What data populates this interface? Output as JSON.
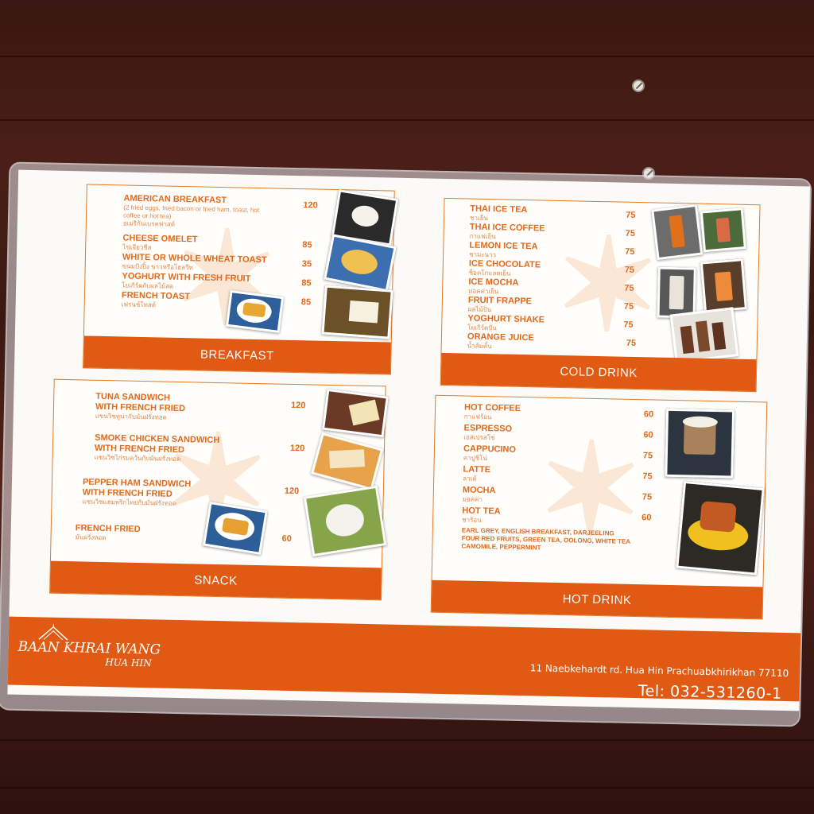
{
  "breakfast": {
    "title": "BREAKFAST",
    "items": [
      {
        "name": "AMERICAN BREAKFAST",
        "desc": "(2 fried eggs, fried bacon or fried ham, toast, hot coffee or hot tea)",
        "thai": "อเมริกันเบรคฟาสต์",
        "price": "120"
      },
      {
        "name": "CHEESE OMELET",
        "thai": "ไข่เจียวชีส",
        "price": "85"
      },
      {
        "name": "WHITE OR WHOLE WHEAT TOAST",
        "thai": "ขนมปังปิ้ง ขาวหรือโฮลวีท",
        "price": "35"
      },
      {
        "name": "YOGHURT WITH FRESH FRUIT",
        "thai": "โยเกิร์ตกับผลไม้สด",
        "price": "85"
      },
      {
        "name": "FRENCH TOAST",
        "thai": "เฟรนช์โทสต์",
        "price": "85"
      }
    ]
  },
  "cold_drink": {
    "title": "COLD DRINK",
    "items": [
      {
        "name": "THAI ICE TEA",
        "thai": "ชาเย็น",
        "price": "75"
      },
      {
        "name": "THAI ICE COFFEE",
        "thai": "กาแฟเย็น",
        "price": "75"
      },
      {
        "name": "LEMON ICE TEA",
        "thai": "ชามะนาว",
        "price": "75"
      },
      {
        "name": "ICE CHOCOLATE",
        "thai": "ช็อคโกแลตเย็น",
        "price": "75"
      },
      {
        "name": "ICE MOCHA",
        "thai": "มอคค่าเย็น",
        "price": "75"
      },
      {
        "name": "FRUIT FRAPPE",
        "thai": "ผลไม้ปั่น",
        "price": "75"
      },
      {
        "name": "YOGHURT SHAKE",
        "thai": "โยเกิร์ตปั่น",
        "price": "75"
      },
      {
        "name": "ORANGE JUICE",
        "thai": "น้ำส้มคั้น",
        "price": "75"
      }
    ]
  },
  "snack": {
    "title": "SNACK",
    "items": [
      {
        "name": "TUNA SANDWICH",
        "name2": "WITH FRENCH FRIED",
        "thai": "แซนวิชทูน่ากับมันฝรั่งทอด",
        "price": "120"
      },
      {
        "name": "SMOKE CHICKEN SANDWICH",
        "name2": "WITH FRENCH FRIED",
        "thai": "แซนวิชไก่รมควันกับมันฝรั่งทอด",
        "price": "120"
      },
      {
        "name": "PEPPER HAM SANDWICH",
        "name2": "WITH FRENCH FRIED",
        "thai": "แซนวิชแฮมพริกไทยกับมันฝรั่งทอด",
        "price": "120"
      },
      {
        "name": "FRENCH FRIED",
        "thai": "มันฝรั่งทอด",
        "price": "60"
      }
    ]
  },
  "hot_drink": {
    "title": "HOT DRINK",
    "items": [
      {
        "name": "HOT COFFEE",
        "thai": "กาแฟร้อน",
        "price": "60"
      },
      {
        "name": "ESPRESSO",
        "thai": "เอสเปรสโซ่",
        "price": "60"
      },
      {
        "name": "CAPPUCINO",
        "thai": "คาปูชิโน่",
        "price": "75"
      },
      {
        "name": "LATTE",
        "thai": "ลาเต้",
        "price": "75"
      },
      {
        "name": "MOCHA",
        "thai": "มอคค่า",
        "price": "75"
      },
      {
        "name": "HOT TEA",
        "thai": "ชาร้อน",
        "price": "60"
      }
    ],
    "tea_note": [
      "EARL GREY, ENGLISH BREAKFAST, DARJEELING",
      "FOUR RED FRUITS, GREEN TEA, OOLONG, WHITE TEA",
      "CAMOMILE, PEPPERMINT"
    ]
  },
  "footer": {
    "logo_main": "BAAN KHRAI WANG",
    "logo_sub": "HUA HIN",
    "address": "11 Naebkehardt rd. Hua Hin Prachuabkhirikhan 77110",
    "tel": "Tel: 032-531260-1"
  },
  "colors": {
    "accent": "#e05a14",
    "text_orange": "#e0691c",
    "wood": "#3e1914"
  }
}
